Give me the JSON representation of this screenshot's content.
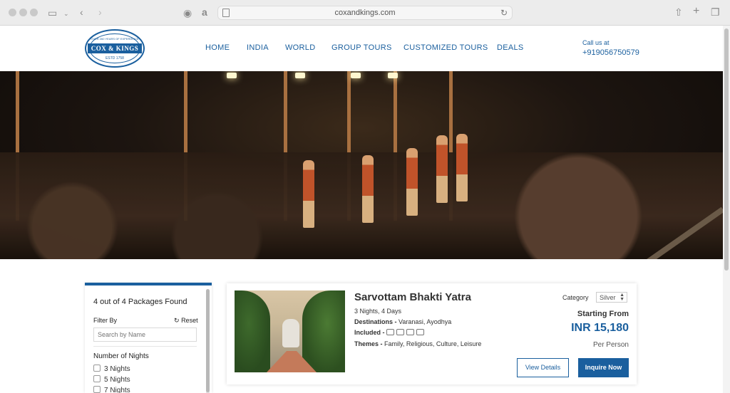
{
  "browser": {
    "url": "coxandkings.com"
  },
  "header": {
    "logo_text": "COX & KINGS",
    "logo_tagline": "OVER 260 YEARS OF EXPERIENCE",
    "logo_est": "ESTD 1758",
    "nav": [
      "HOME",
      "INDIA",
      "WORLD",
      "GROUP TOURS",
      "CUSTOMIZED TOURS",
      "DEALS"
    ],
    "call_label": "Call us at",
    "phone": "+919056750579"
  },
  "filter": {
    "found": "4 out of 4 Packages Found",
    "filter_by": "Filter By",
    "reset": "Reset",
    "search_placeholder": "Search by Name",
    "nights_title": "Number of Nights",
    "nights_options": [
      "3 Nights",
      "5 Nights",
      "7 Nights"
    ]
  },
  "package": {
    "title": "Sarvottam Bhakti Yatra",
    "duration": "3 Nights, 4 Days",
    "destinations_label": "Destinations -",
    "destinations": "Varanasi, Ayodhya",
    "included_label": "Included -",
    "themes_label": "Themes -",
    "themes": "Family, Religious, Culture, Leisure",
    "category_label": "Category",
    "category_value": "Silver",
    "starting_from": "Starting From",
    "price": "INR 15,180",
    "per_person": "Per Person",
    "view_details": "View Details",
    "inquire_now": "Inquire Now"
  },
  "colors": {
    "brand_blue": "#1a5f9e"
  }
}
